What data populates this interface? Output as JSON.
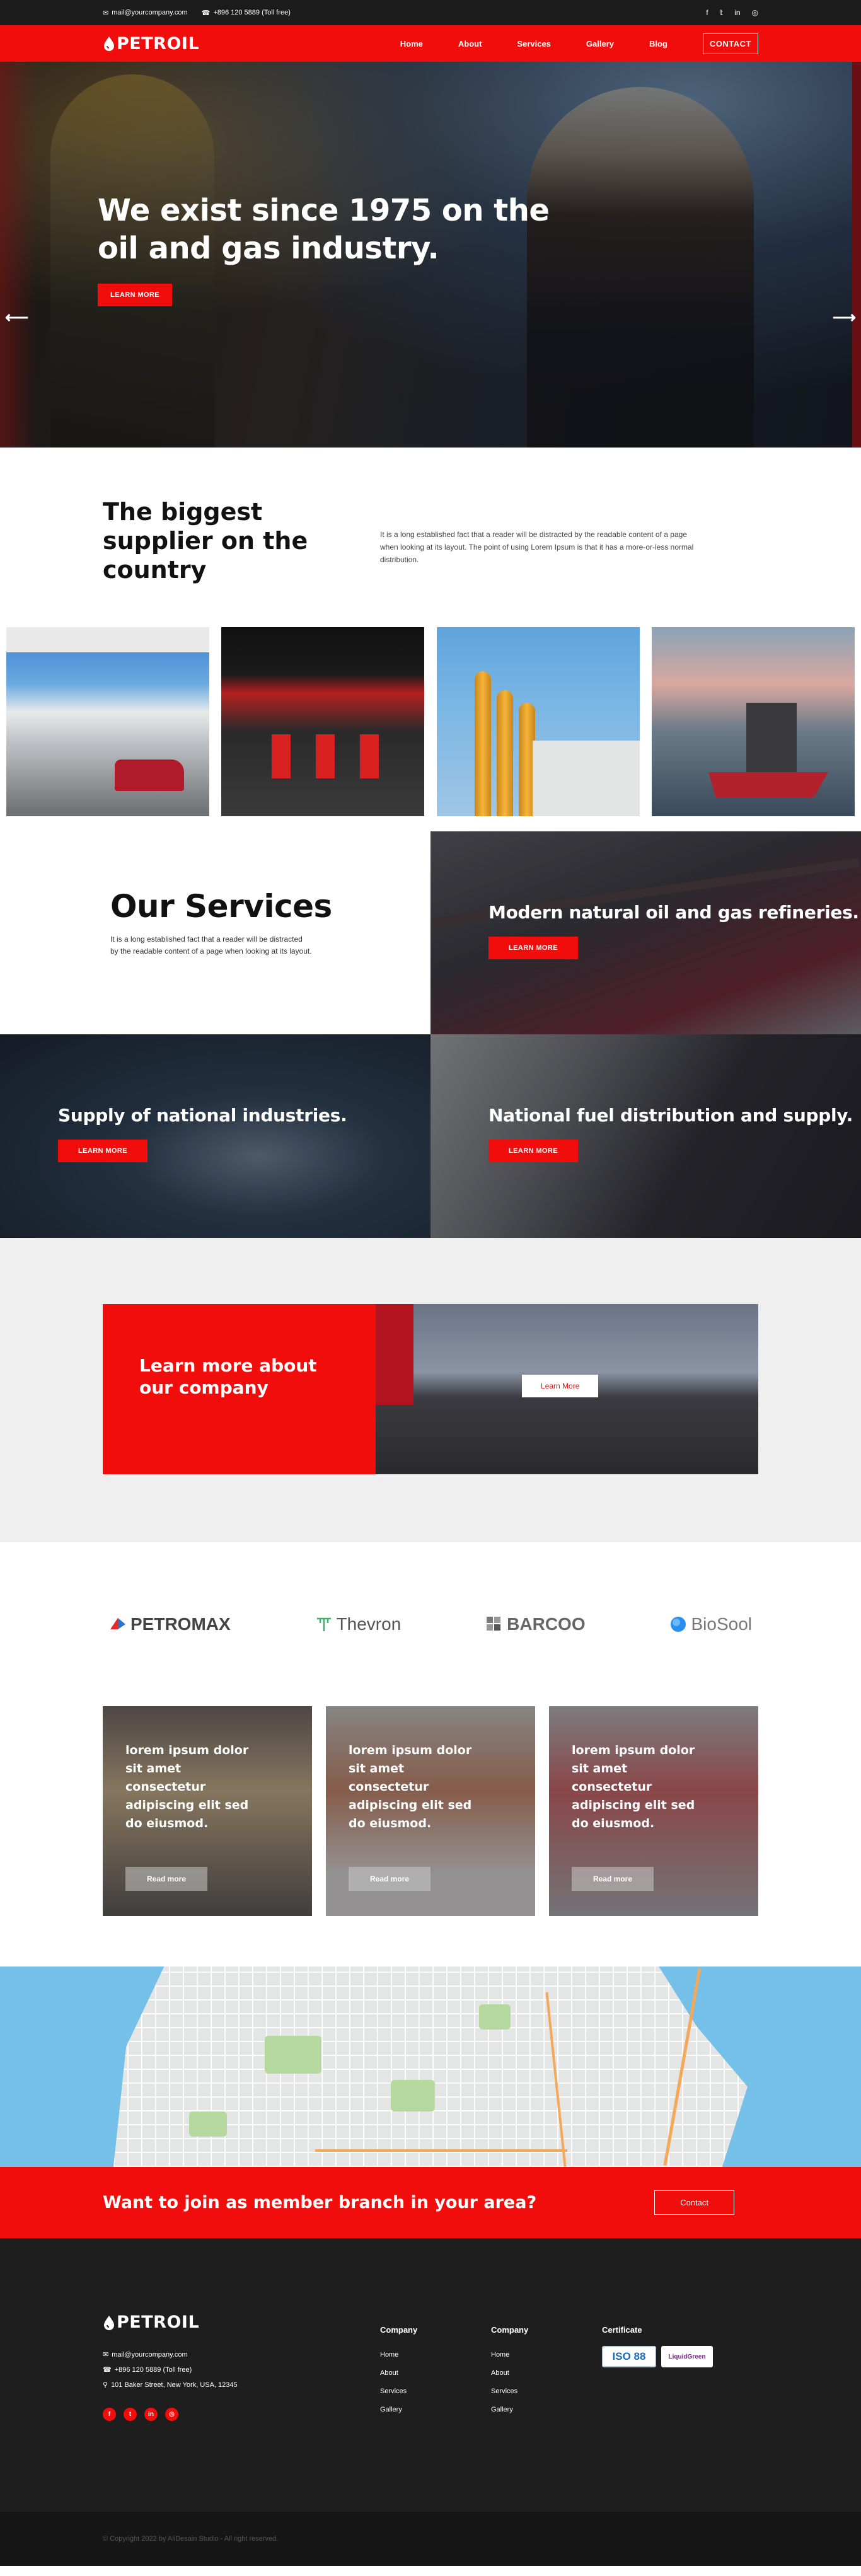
{
  "topbar": {
    "email": "mail@yourcompany.com",
    "phone": "+896 120 5889 (Toll free)",
    "social_icons": [
      "facebook-icon",
      "twitter-icon",
      "linkedin-icon",
      "instagram-icon"
    ]
  },
  "nav": {
    "logo": "PETROIL",
    "items": [
      "Home",
      "About",
      "Services",
      "Gallery",
      "Blog"
    ],
    "contact_label": "CONTACT"
  },
  "hero": {
    "title": "We exist since 1975 on the oil and gas industry.",
    "button": "LEARN MORE"
  },
  "supplier": {
    "title": "The biggest supplier on the country",
    "text": "It is a long established fact that a reader will be distracted by the readable content of a page when looking at its layout. The point of using Lorem Ipsum is that it has a more-or-less normal distribution."
  },
  "services": {
    "title": "Our Services",
    "text": "It is a long established fact that a reader will be distracted by the readable content of a page when looking at its layout.",
    "items": [
      {
        "title": "Modern natural oil and gas refineries.",
        "button": "LEARN MORE"
      },
      {
        "title": "Supply of national industries.",
        "button": "LEARN MORE"
      },
      {
        "title": "National fuel distribution and supply.",
        "button": "LEARN MORE"
      }
    ]
  },
  "cta": {
    "title": "Learn more about our company",
    "button": "Learn More"
  },
  "brands": [
    "PETROMAX",
    "Thevron",
    "BARCOO",
    "BioSool"
  ],
  "cards": [
    {
      "title": "lorem ipsum dolor sit amet consectetur adipiscing elit sed do eiusmod.",
      "button": "Read more"
    },
    {
      "title": "lorem ipsum dolor sit amet consectetur adipiscing elit sed do eiusmod.",
      "button": "Read more"
    },
    {
      "title": "lorem ipsum dolor sit amet consectetur adipiscing elit sed do eiusmod.",
      "button": "Read more"
    }
  ],
  "member": {
    "title": "Want to join as member branch in your area?",
    "button": "Contact"
  },
  "footer": {
    "logo": "PETROIL",
    "email": "mail@yourcompany.com",
    "phone": "+896 120 5889 (Toll free)",
    "address": "101 Baker Street, New York, USA, 12345",
    "col1": {
      "title": "Company",
      "links": [
        "Home",
        "About",
        "Services",
        "Gallery"
      ]
    },
    "col2": {
      "title": "Company",
      "links": [
        "Home",
        "About",
        "Services",
        "Gallery"
      ]
    },
    "col3": {
      "title": "Certificate",
      "badges": [
        "ISO 88",
        "LiquidGreen"
      ]
    },
    "social_icons": [
      "facebook-icon",
      "twitter-icon",
      "linkedin-icon",
      "instagram-icon"
    ]
  },
  "copyright": "© Copyright 2022 by AliDesain Studio - All right reserved.",
  "colors": {
    "accent": "#f20d0d",
    "dark": "#1e1e1e"
  }
}
